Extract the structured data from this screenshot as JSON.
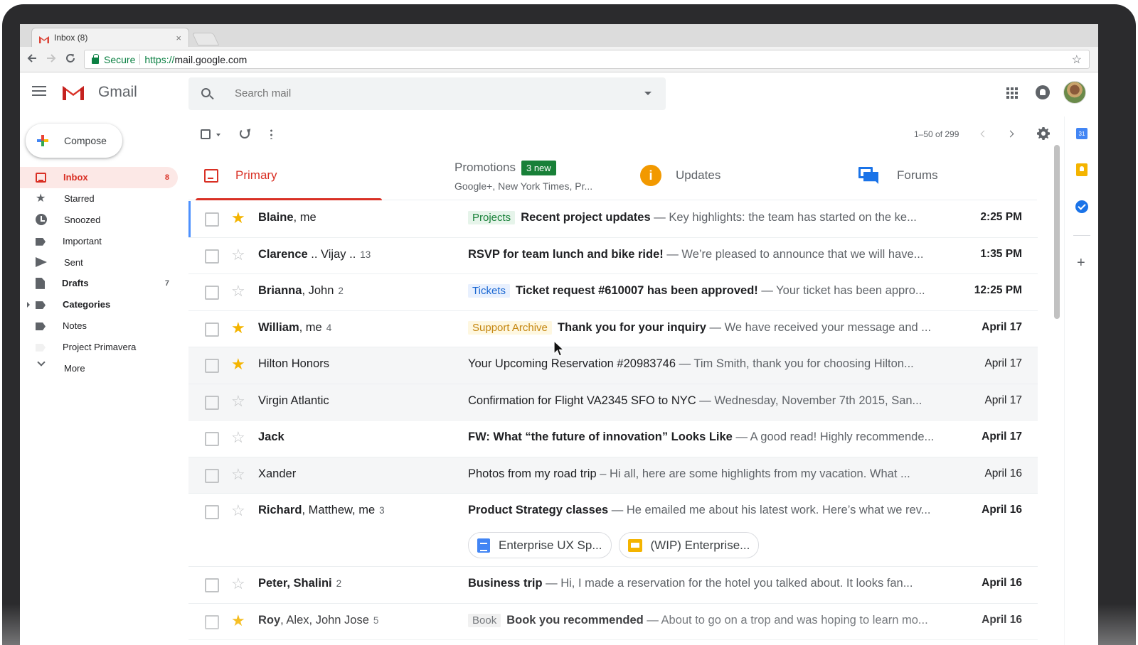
{
  "browser": {
    "tab_title": "Inbox (8)",
    "tab_close": "×",
    "secure_label": "Secure",
    "url_scheme": "https://",
    "url_host": "mail.google.com"
  },
  "gmail": {
    "product_name": "Gmail",
    "search_placeholder": "Search mail"
  },
  "compose_label": "Compose",
  "nav": [
    {
      "label": "Inbox",
      "count": "8",
      "icon": "inbox-icon"
    },
    {
      "label": "Starred",
      "count": "",
      "icon": "star-icon"
    },
    {
      "label": "Snoozed",
      "count": "",
      "icon": "clock-icon"
    },
    {
      "label": "Important",
      "count": "",
      "icon": "important-icon"
    },
    {
      "label": "Sent",
      "count": "",
      "icon": "send-icon"
    },
    {
      "label": "Drafts",
      "count": "7",
      "icon": "draft-icon"
    },
    {
      "label": "Categories",
      "count": "",
      "icon": "label-icon"
    },
    {
      "label": "Notes",
      "count": "",
      "icon": "label-icon"
    },
    {
      "label": "Project Primavera",
      "count": "",
      "icon": "label-icon"
    },
    {
      "label": "More",
      "count": "",
      "icon": "chevron-down-icon"
    }
  ],
  "list_toolbar": {
    "pagination": "1–50 of 299"
  },
  "categories": {
    "primary": "Primary",
    "promotions": "Promotions",
    "promotions_badge": "3 new",
    "promotions_sub": "Google+, New York Times, Pr...",
    "updates": "Updates",
    "updates_icon_glyph": "i",
    "forums": "Forums"
  },
  "messages": [
    {
      "sender_bold": "Blaine",
      "sender_rest": ", me",
      "count": "",
      "starred": true,
      "chip": "Projects",
      "chip_color": "#188038",
      "subject": "Recent project updates",
      "snippet": " — Key highlights: the team has started on the ke...",
      "date": "2:25 PM",
      "unread": true
    },
    {
      "sender_bold": "Clarence",
      "sender_rest": " .. Vijay ..",
      "count": "13",
      "starred": false,
      "chip": "",
      "subject": "RSVP for team lunch and bike ride!",
      "snippet": " — We’re pleased to announce that we will have...",
      "date": "1:35 PM",
      "unread": true
    },
    {
      "sender_bold": "Brianna",
      "sender_rest": ", John",
      "count": "2",
      "starred": false,
      "chip": "Tickets",
      "chip_color": "#1967d2",
      "subject": "Ticket request #610007 has been approved!",
      "snippet": " — Your ticket has been appro...",
      "date": "12:25 PM",
      "unread": true
    },
    {
      "sender_bold": "William",
      "sender_rest": ", me",
      "count": "4",
      "starred": true,
      "chip": "Support Archive",
      "chip_color": "#c5860f",
      "subject": "Thank you for your inquiry",
      "snippet": " — We have received your message and ...",
      "date": "April 17",
      "unread": true
    },
    {
      "sender_bold": "",
      "sender_rest": "Hilton Honors",
      "count": "",
      "starred": true,
      "chip": "",
      "subject": "Your Upcoming Reservation #20983746",
      "snippet": " — Tim Smith, thank you for choosing Hilton...",
      "date": "April 17",
      "unread": false
    },
    {
      "sender_bold": "",
      "sender_rest": "Virgin Atlantic",
      "count": "",
      "starred": false,
      "chip": "",
      "subject": "Confirmation for Flight VA2345 SFO to NYC",
      "snippet": " — Wednesday, November 7th 2015, San...",
      "date": "April 17",
      "unread": false
    },
    {
      "sender_bold": "Jack",
      "sender_rest": "",
      "count": "",
      "starred": false,
      "chip": "",
      "subject": "FW: What “the future of innovation” Looks Like",
      "snippet": " — A good read! Highly recommende...",
      "date": "April 17",
      "unread": true
    },
    {
      "sender_bold": "",
      "sender_rest": "Xander",
      "count": "",
      "starred": false,
      "chip": "",
      "subject": "Photos from my road trip",
      "snippet": " – Hi all, here are some highlights from my vacation. What ...",
      "date": "April 16",
      "unread": false
    },
    {
      "sender_bold": "Richard",
      "sender_rest": ", Matthew, me",
      "count": "3",
      "starred": false,
      "chip": "",
      "subject": "Product Strategy classes",
      "snippet": " — He emailed me about his latest work. Here’s what we rev...",
      "date": "April 16",
      "unread": true,
      "attachments": [
        {
          "name": "Enterprise UX Sp...",
          "icon": "docs-icon"
        },
        {
          "name": "(WIP) Enterprise...",
          "icon": "slides-icon"
        }
      ]
    },
    {
      "sender_bold": "Peter, Shalini",
      "sender_rest": "",
      "count": "2",
      "starred": false,
      "chip": "",
      "subject": "Business trip",
      "snippet": " — Hi, I made a reservation for the hotel you talked about. It looks fan...",
      "date": "April 16",
      "unread": true
    },
    {
      "sender_bold": "Roy",
      "sender_rest": ", Alex, John Jose",
      "count": "5",
      "starred": true,
      "chip": "Book",
      "chip_color": "#5f6368",
      "subject": "Book you recommended",
      "snippet": " — About to go on a trop and was hoping to learn mo...",
      "date": "April 16",
      "unread": true
    }
  ],
  "rail": {
    "calendar_day": "31",
    "add_glyph": "+"
  },
  "colors": {
    "accent_red": "#d93025",
    "star_yellow": "#f4b400",
    "badge_green": "#188038"
  }
}
